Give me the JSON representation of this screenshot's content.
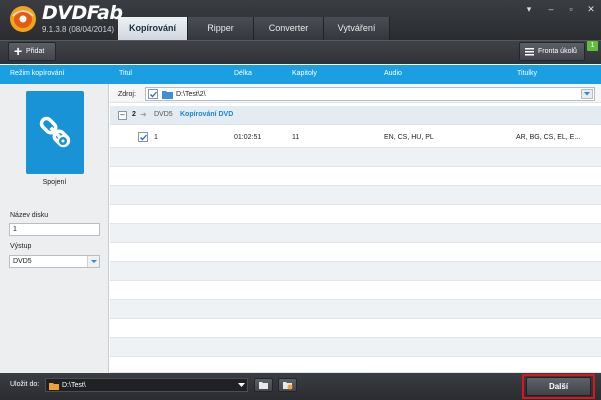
{
  "app": {
    "brand": "DVDFab",
    "version": "9.1.3.8 (08/04/2014)"
  },
  "tabs": [
    {
      "label": "Kopírování",
      "active": true
    },
    {
      "label": "Ripper",
      "active": false
    },
    {
      "label": "Converter",
      "active": false
    },
    {
      "label": "Vytváření",
      "active": false
    }
  ],
  "toolbar": {
    "add_label": "Přidat",
    "queue_label": "Fronta úkolů",
    "queue_count": "1"
  },
  "columns": {
    "mode": "Režim kopírování",
    "title": "Titul",
    "length": "Délka",
    "chapters": "Kapitoly",
    "audio": "Audio",
    "subtitles": "Titulky"
  },
  "left": {
    "mode_name": "Spojení",
    "disc_label": "Název disku",
    "disc_value": "1",
    "output_label": "Výstup",
    "output_value": "DVD5"
  },
  "source": {
    "label": "Zdroj:",
    "path": "D:\\Test\\2\\"
  },
  "group": {
    "number": "2",
    "format": "DVD5",
    "mode_text": "Kopírování DVD"
  },
  "titles": [
    {
      "title": "1",
      "length": "01:02:51",
      "chapters": "11",
      "audio": "EN, CS, HU, PL",
      "subtitles": "AR, BG, CS, EL, E..."
    }
  ],
  "bottom": {
    "save_label": "Uložit do:",
    "save_path": "D:\\Test\\",
    "next_label": "Další"
  },
  "colors": {
    "accent": "#1a9fe3",
    "tile": "#1793d6",
    "highlight": "#d8161b",
    "badge": "#5fbf3a"
  }
}
